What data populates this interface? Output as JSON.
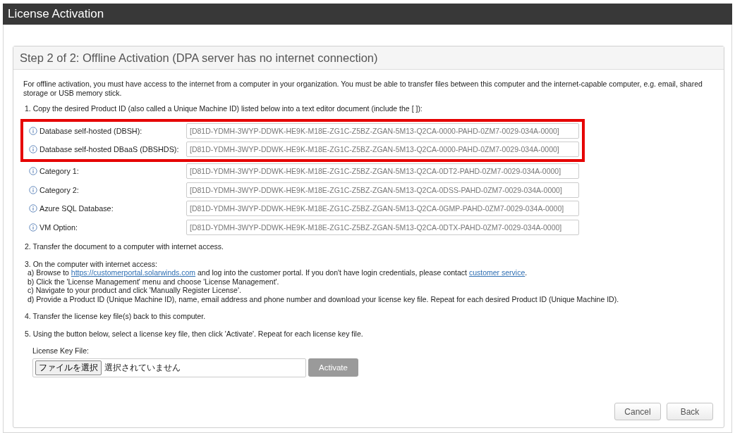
{
  "window": {
    "title": "License Activation"
  },
  "panel": {
    "title": "Step 2 of 2: Offline Activation (DPA server has no internet connection)"
  },
  "intro": "For offline activation, you must have access to the internet from a computer in your organization. You must be able to transfer files between this computer and the internet-capable computer, e.g. email, shared storage or USB memory stick.",
  "step1": "1. Copy the desired Product ID (also called a Unique Machine ID) listed below into a text editor document (include the [ ]):",
  "products": [
    {
      "label": "Database self-hosted (DBSH):",
      "value": "[D81D-YDMH-3WYP-DDWK-HE9K-M18E-ZG1C-Z5BZ-ZGAN-5M13-Q2CA-0000-PAHD-0ZM7-0029-034A-0000]",
      "highlighted": true
    },
    {
      "label": "Database self-hosted DBaaS (DBSHDS):",
      "value": "[D81D-YDMH-3WYP-DDWK-HE9K-M18E-ZG1C-Z5BZ-ZGAN-5M13-Q2CA-0000-PAHD-0ZM7-0029-034A-0000]",
      "highlighted": true
    },
    {
      "label": "Category 1:",
      "value": "[D81D-YDMH-3WYP-DDWK-HE9K-M18E-ZG1C-Z5BZ-ZGAN-5M13-Q2CA-0DT2-PAHD-0ZM7-0029-034A-0000]",
      "highlighted": false
    },
    {
      "label": "Category 2:",
      "value": "[D81D-YDMH-3WYP-DDWK-HE9K-M18E-ZG1C-Z5BZ-ZGAN-5M13-Q2CA-0DSS-PAHD-0ZM7-0029-034A-0000]",
      "highlighted": false
    },
    {
      "label": "Azure SQL Database:",
      "value": "[D81D-YDMH-3WYP-DDWK-HE9K-M18E-ZG1C-Z5BZ-ZGAN-5M13-Q2CA-0GMP-PAHD-0ZM7-0029-034A-0000]",
      "highlighted": false
    },
    {
      "label": "VM Option:",
      "value": "[D81D-YDMH-3WYP-DDWK-HE9K-M18E-ZG1C-Z5BZ-ZGAN-5M13-Q2CA-0DTX-PAHD-0ZM7-0029-034A-0000]",
      "highlighted": false
    }
  ],
  "step2": "2. Transfer the document to a computer with internet access.",
  "step3": {
    "heading": "3. On the computer with internet access:",
    "lines": [
      [
        {
          "kind": "text",
          "text": "a) Browse to "
        },
        {
          "kind": "link",
          "text": "https://customerportal.solarwinds.com"
        },
        {
          "kind": "text",
          "text": " and log into the customer portal. If you don't have login credentials, please contact "
        },
        {
          "kind": "link",
          "text": "customer service"
        },
        {
          "kind": "text",
          "text": "."
        }
      ],
      [
        {
          "kind": "text",
          "text": "b) Click the 'License Management' menu and choose 'License Management'."
        }
      ],
      [
        {
          "kind": "text",
          "text": "c) Navigate to your product and click 'Manually Register License'."
        }
      ],
      [
        {
          "kind": "text",
          "text": "d) Provide a Product ID (Unique Machine ID), name, email address and phone number and download your license key file. Repeat for each desired Product ID (Unique Machine ID)."
        }
      ]
    ]
  },
  "step4": "4. Transfer the license key file(s) back to this computer.",
  "step5": "5. Using the button below, select a license key file, then click 'Activate'. Repeat for each license key file.",
  "file": {
    "label": "License Key File:",
    "button": "ファイルを選択",
    "status": "選択されていません"
  },
  "activate": {
    "label": "Activate",
    "disabled": true
  },
  "buttons": [
    "Cancel",
    "Back"
  ]
}
